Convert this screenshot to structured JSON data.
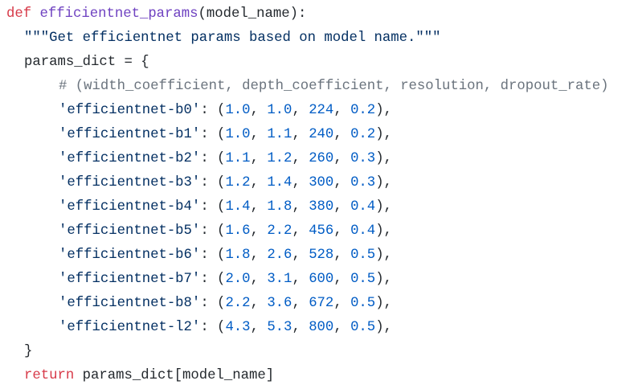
{
  "colors": {
    "keyword": "#d73a49",
    "function": "#6f42c1",
    "string": "#032f62",
    "number": "#005cc5",
    "comment": "#6a737d",
    "text": "#24292e"
  },
  "code": {
    "def_kw": "def",
    "func_name": "efficientnet_params",
    "signature": "(model_name):",
    "docstring": "\"\"\"Get efficientnet params based on model name.\"\"\"",
    "dict_var": "params_dict",
    "assign": " = {",
    "comment": "# (width_coefficient, depth_coefficient, resolution, dropout_rate)",
    "entries": [
      {
        "key": "'efficientnet-b0'",
        "w": "1.0",
        "d": "1.0",
        "r": "224",
        "p": "0.2"
      },
      {
        "key": "'efficientnet-b1'",
        "w": "1.0",
        "d": "1.1",
        "r": "240",
        "p": "0.2"
      },
      {
        "key": "'efficientnet-b2'",
        "w": "1.1",
        "d": "1.2",
        "r": "260",
        "p": "0.3"
      },
      {
        "key": "'efficientnet-b3'",
        "w": "1.2",
        "d": "1.4",
        "r": "300",
        "p": "0.3"
      },
      {
        "key": "'efficientnet-b4'",
        "w": "1.4",
        "d": "1.8",
        "r": "380",
        "p": "0.4"
      },
      {
        "key": "'efficientnet-b5'",
        "w": "1.6",
        "d": "2.2",
        "r": "456",
        "p": "0.4"
      },
      {
        "key": "'efficientnet-b6'",
        "w": "1.8",
        "d": "2.6",
        "r": "528",
        "p": "0.5"
      },
      {
        "key": "'efficientnet-b7'",
        "w": "2.0",
        "d": "3.1",
        "r": "600",
        "p": "0.5"
      },
      {
        "key": "'efficientnet-b8'",
        "w": "2.2",
        "d": "3.6",
        "r": "672",
        "p": "0.5"
      },
      {
        "key": "'efficientnet-l2'",
        "w": "4.3",
        "d": "5.3",
        "r": "800",
        "p": "0.5"
      }
    ],
    "close_brace": "}",
    "return_kw": "return",
    "return_expr": " params_dict[model_name]"
  }
}
